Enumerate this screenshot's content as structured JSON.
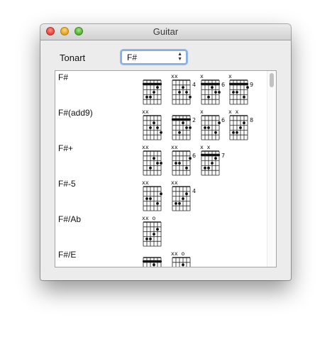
{
  "window": {
    "title": "Guitar"
  },
  "key": {
    "label": "Tonart",
    "value": "F#",
    "arrow_up": "▲",
    "arrow_down": "▼"
  },
  "chords": [
    {
      "name": "F#",
      "variants": [
        {
          "barre": true,
          "nut": "",
          "fret": "",
          "markers": []
        },
        {
          "barre": false,
          "nut": "xx",
          "fret": "4",
          "markers": []
        },
        {
          "barre": true,
          "nut": "x",
          "fret": "6",
          "markers": []
        },
        {
          "barre": true,
          "nut": "x",
          "fret": "9",
          "markers": []
        }
      ]
    },
    {
      "name": "F#(add9)",
      "variants": [
        {
          "barre": false,
          "nut": "xx",
          "fret": "",
          "markers": []
        },
        {
          "barre": true,
          "nut": "",
          "fret": "2",
          "markers": []
        },
        {
          "barre": false,
          "nut": "x",
          "fret": "6",
          "markers": []
        },
        {
          "barre": false,
          "nut": "x x",
          "fret": "8",
          "markers": []
        }
      ]
    },
    {
      "name": "F#+",
      "variants": [
        {
          "barre": false,
          "nut": "xx",
          "fret": "",
          "markers": []
        },
        {
          "barre": false,
          "nut": "xx",
          "fret": "6",
          "markers": []
        },
        {
          "barre": true,
          "nut": "x  x",
          "fret": "7",
          "markers": []
        }
      ]
    },
    {
      "name": "F#-5",
      "variants": [
        {
          "barre": false,
          "nut": "xx",
          "fret": "",
          "markers": []
        },
        {
          "barre": false,
          "nut": "xx",
          "fret": "4",
          "markers": []
        }
      ]
    },
    {
      "name": "F#/Ab",
      "variants": [
        {
          "barre": false,
          "nut": "xx o",
          "fret": "",
          "markers": []
        }
      ]
    },
    {
      "name": "F#/E",
      "variants": [
        {
          "barre": true,
          "nut": "",
          "fret": "",
          "markers": []
        },
        {
          "barre": false,
          "nut": "xx   o",
          "fret": "",
          "markers": []
        }
      ]
    }
  ]
}
